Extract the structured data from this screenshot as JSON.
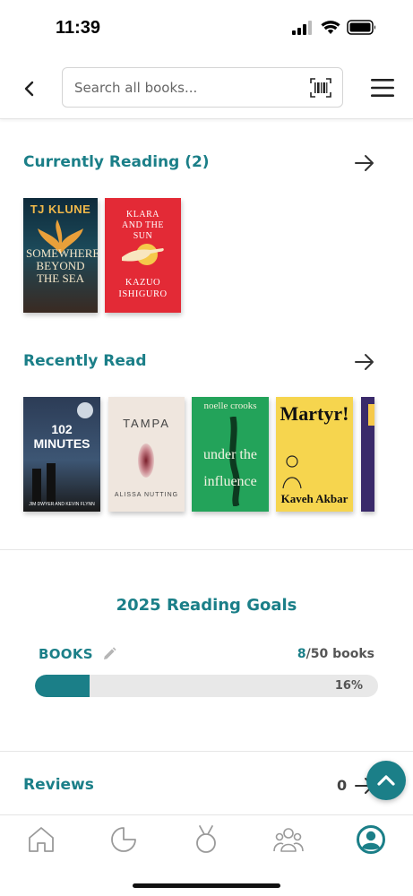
{
  "status": {
    "time": "11:39"
  },
  "search": {
    "placeholder": "Search all books..."
  },
  "currently_reading": {
    "title": "Currently Reading (2)",
    "books": [
      {
        "author": "TJ KLUNE",
        "title": "SOMEWHERE BEYOND THE SEA"
      },
      {
        "title": "KLARA AND THE SUN",
        "author": "KAZUO ISHIGURO"
      }
    ]
  },
  "recently_read": {
    "title": "Recently Read",
    "books": [
      {
        "title": "102 MINUTES",
        "author": "JIM DWYER AND KEVIN FLYNN"
      },
      {
        "title": "TAMPA",
        "author": "ALISSA NUTTING"
      },
      {
        "author": "noelle crooks",
        "title": "under the influence"
      },
      {
        "title": "Martyr!",
        "author": "Kaveh Akbar"
      },
      {
        "title": "",
        "author": ""
      }
    ]
  },
  "goals": {
    "title": "2025 Reading Goals",
    "category": "BOOKS",
    "current": "8",
    "total_text": "/50 books",
    "percent_label": "16%",
    "progress": 0.16
  },
  "reviews": {
    "label": "Reviews",
    "count": "0"
  },
  "tabs": [
    "home-icon",
    "moon-icon",
    "medal-icon",
    "community-icon",
    "profile-icon"
  ],
  "colors": {
    "accent": "#1b7f88"
  }
}
